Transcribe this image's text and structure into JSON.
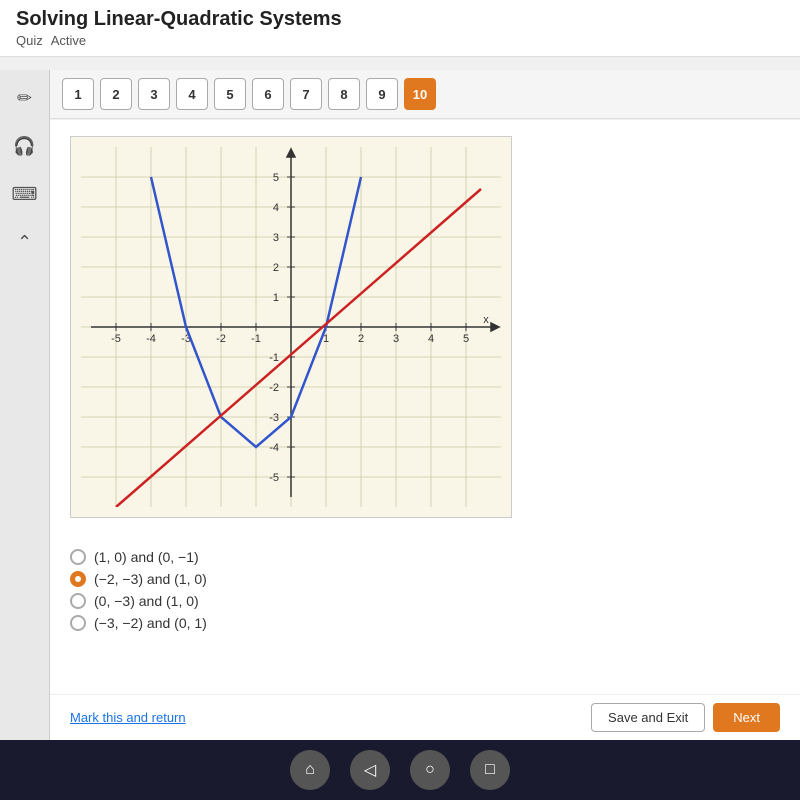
{
  "header": {
    "title": "Solving Linear-Quadratic Systems",
    "quiz_label": "Quiz",
    "status": "Active"
  },
  "question_bar": {
    "buttons": [
      1,
      2,
      3,
      4,
      5,
      6,
      7,
      8,
      9,
      10
    ],
    "active": 10
  },
  "sidebar": {
    "icons": [
      {
        "name": "pencil-icon",
        "symbol": "✏"
      },
      {
        "name": "headphone-icon",
        "symbol": "🎧"
      },
      {
        "name": "calculator-icon",
        "symbol": "⌨"
      },
      {
        "name": "expand-icon",
        "symbol": "⌃"
      }
    ]
  },
  "choices": [
    {
      "id": "a",
      "text": "(1, 0) and (0, −1)",
      "selected": false
    },
    {
      "id": "b",
      "text": "(−2, −3) and (1, 0)",
      "selected": true
    },
    {
      "id": "c",
      "text": "(0, −3) and (1, 0)",
      "selected": false
    },
    {
      "id": "d",
      "text": "(−3, −2) and (0, 1)",
      "selected": false
    }
  ],
  "bottom": {
    "mark_return": "Mark this and return",
    "save_exit": "Save and Exit",
    "next": "Next"
  },
  "colors": {
    "accent": "#e07820",
    "parabola": "#3355cc",
    "line": "#cc2222",
    "grid": "#c8c8a0",
    "axis": "#333333"
  }
}
